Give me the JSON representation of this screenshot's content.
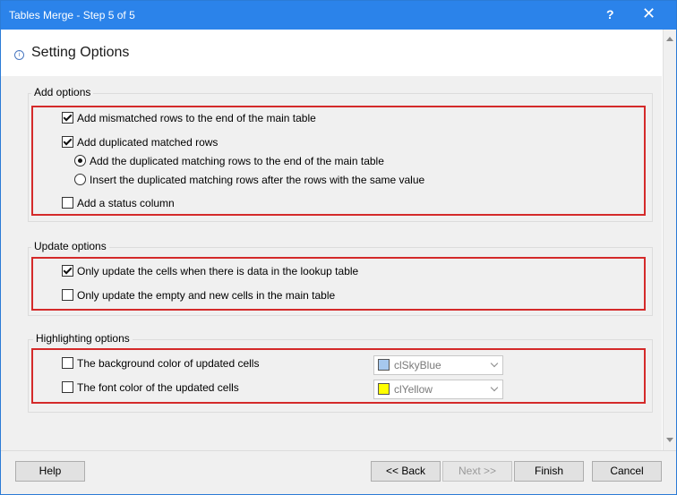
{
  "window": {
    "title": "Tables Merge - Step 5 of 5",
    "help_glyph": "?",
    "close_glyph": "✕"
  },
  "header": {
    "title": "Setting Options"
  },
  "add_options": {
    "label": "Add options",
    "mismatched": "Add mismatched rows to the end of the main table",
    "duplicated": "Add duplicated matched rows",
    "dup_end": "Add the duplicated matching rows to the end of the main table",
    "dup_insert": "Insert the duplicated matching rows after the rows with the same value",
    "status_column": "Add a status column"
  },
  "update_options": {
    "label": "Update options",
    "only_lookup": "Only update the cells when there is data in the lookup table",
    "only_empty": "Only update the empty and new cells in the main table"
  },
  "highlight_options": {
    "label": "Highlighting options",
    "background_label": "The background color of updated cells",
    "background_value": "clSkyBlue",
    "background_swatch": "#a6c8ee",
    "font_label": "The font color of the updated cells",
    "font_value": "clYellow",
    "font_swatch": "#ffff00"
  },
  "buttons": {
    "help": "Help",
    "back": "<< Back",
    "next": "Next >>",
    "finish": "Finish",
    "cancel": "Cancel"
  }
}
